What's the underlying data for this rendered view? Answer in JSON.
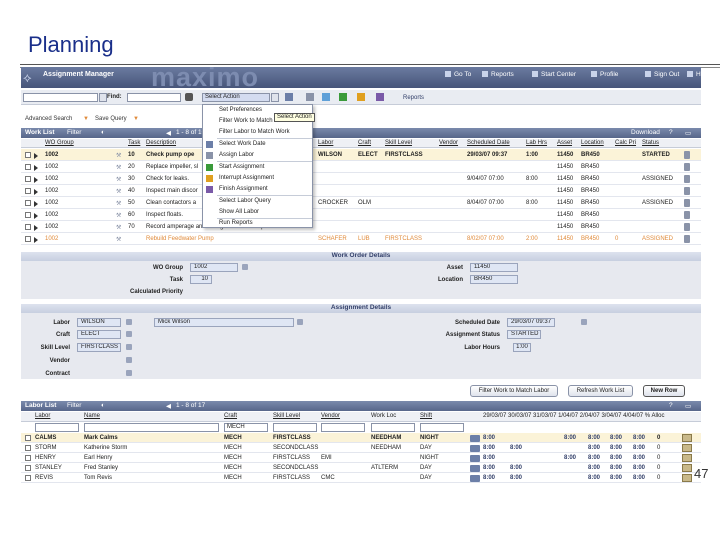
{
  "slide": {
    "title": "Planning",
    "page_number": "47"
  },
  "app": {
    "logo_glyph": "⟡",
    "title": "Assignment Manager",
    "watermark": "maximo",
    "nav": [
      "Go To",
      "Reports",
      "Start Center",
      "Profile",
      "Sign Out",
      "He"
    ]
  },
  "toolbar": {
    "find_label": "Find:",
    "action_select": "Select Action",
    "reports_label": "Reports"
  },
  "links": {
    "advanced_search": "Advanced Search",
    "save_query": "Save Query"
  },
  "work_list": {
    "title": "Work List",
    "filter": "Filter",
    "paging": "1 - 8 of 10",
    "download": "Download",
    "columns": [
      "WO Group",
      "Task",
      "Description",
      "Labor",
      "Craft",
      "Skill Level",
      "Vendor",
      "Scheduled Date",
      "Lab Hrs",
      "Asset",
      "Location",
      "Calc Pri",
      "Status"
    ],
    "rows": [
      {
        "wo": "1002",
        "task": "10",
        "desc": "Check pump ope",
        "labor": "WILSON",
        "craft": "ELECT",
        "skill": "FIRSTCLASS",
        "vendor": "",
        "date": "29/03/07 09:37",
        "hrs": "1:00",
        "asset": "11450",
        "loc": "BR450",
        "pri": "",
        "status": "STARTED"
      },
      {
        "wo": "1002",
        "task": "20",
        "desc": "Replace impeller, sl",
        "labor": "",
        "craft": "",
        "skill": "",
        "vendor": "",
        "date": "",
        "hrs": "",
        "asset": "11450",
        "loc": "BR450",
        "pri": "",
        "status": ""
      },
      {
        "wo": "1002",
        "task": "30",
        "desc": "Check for leaks.",
        "labor": "",
        "craft": "",
        "skill": "",
        "vendor": "",
        "date": "9/04/07 07:00",
        "hrs": "8:00",
        "asset": "11450",
        "loc": "BR450",
        "pri": "",
        "status": "ASSIGNED"
      },
      {
        "wo": "1002",
        "task": "40",
        "desc": "Inspect main discor",
        "labor": "",
        "craft": "",
        "skill": "",
        "vendor": "",
        "date": "",
        "hrs": "",
        "asset": "11450",
        "loc": "BR450",
        "pri": "",
        "status": ""
      },
      {
        "wo": "1002",
        "task": "50",
        "desc": "Clean contactors a",
        "labor": "CROCKER",
        "craft": "OLM",
        "skill": "",
        "vendor": "",
        "date": "8/04/07 07:00",
        "hrs": "8:00",
        "asset": "11450",
        "loc": "BR450",
        "pri": "",
        "status": "ASSIGNED"
      },
      {
        "wo": "1002",
        "task": "60",
        "desc": "Inspect floats.",
        "labor": "",
        "craft": "",
        "skill": "",
        "vendor": "",
        "date": "",
        "hrs": "",
        "asset": "11450",
        "loc": "BR450",
        "pri": "",
        "status": ""
      },
      {
        "wo": "1002",
        "task": "70",
        "desc": "Record amperage and voltage with motor op...",
        "labor": "",
        "craft": "",
        "skill": "",
        "vendor": "",
        "date": "",
        "hrs": "",
        "asset": "11450",
        "loc": "BR450",
        "pri": "",
        "status": ""
      },
      {
        "wo": "1002",
        "task": "",
        "desc": "Rebuild Feedwater Pump",
        "labor": "SCHAFER",
        "craft": "LUB",
        "skill": "FIRSTCLASS",
        "vendor": "",
        "date": "8/02/07 07:00",
        "hrs": "2:00",
        "asset": "11450",
        "loc": "BR450",
        "pri": "0",
        "status": "ASSIGNED"
      }
    ]
  },
  "menu": {
    "items": [
      "Set Preferences",
      "Filter Work to Match Labor",
      "Filter Labor to Match Work",
      "Select Work Date",
      "Assign Labor",
      "Start Assignment",
      "Interrupt Assignment",
      "Finish Assignment",
      "Select Labor Query",
      "Show All Labor",
      "Run Reports"
    ],
    "tooltip": "Select Action"
  },
  "work_order_details": {
    "title": "Work Order Details",
    "wo_group_label": "WO Group",
    "wo_group": "1002",
    "task_label": "Task",
    "task": "10",
    "calc_priority_label": "Calculated Priority",
    "asset_label": "Asset",
    "asset": "11450",
    "location_label": "Location",
    "location": "BR450"
  },
  "assignment_details": {
    "title": "Assignment Details",
    "labor_label": "Labor",
    "labor": "WILSON",
    "labor_name": "Mick Wilson",
    "craft_label": "Craft",
    "craft": "ELECT",
    "skill_label": "Skill Level",
    "skill": "FIRSTCLASS",
    "vendor_label": "Vendor",
    "contract_label": "Contract",
    "sched_label": "Scheduled Date",
    "sched": "29/03/07 09:37",
    "status_label": "Assignment Status",
    "status": "STARTED",
    "hours_label": "Labor Hours",
    "hours": "1:00"
  },
  "buttons": {
    "filter_work": "Filter Work to Match Labor",
    "refresh": "Refresh Work List",
    "new_row": "New Row"
  },
  "labor_list": {
    "title": "Labor List",
    "filter": "Filter",
    "paging": "1 - 8 of 17",
    "columns": [
      "Labor",
      "Name",
      "Craft",
      "Skill Level",
      "Vendor",
      "Work Loc",
      "Shift"
    ],
    "dates": "29/03/07 30/03/07 31/03/07 1/04/07 2/04/07 3/04/07 4/04/07 % Alloc",
    "craft_filter": "MECH",
    "rows": [
      {
        "labor": "CALMS",
        "name": "Mark Calms",
        "craft": "MECH",
        "skill": "FIRSTCLASS",
        "vendor": "",
        "loc": "NEEDHAM",
        "shift": "NIGHT",
        "h1": "8:00",
        "h2": "",
        "h3": "8:00",
        "h4": "8:00",
        "h5": "8:00",
        "h6": "8:00",
        "pct": "0",
        "bold": true
      },
      {
        "labor": "STORM",
        "name": "Katherine Storm",
        "craft": "MECH",
        "skill": "SECONDCLASS",
        "vendor": "",
        "loc": "NEEDHAM",
        "shift": "DAY",
        "h1": "8:00",
        "h2": "8:00",
        "h3": "",
        "h4": "8:00",
        "h5": "8:00",
        "h6": "8:00",
        "pct": "0",
        "bold": false
      },
      {
        "labor": "HENRY",
        "name": "Earl Henry",
        "craft": "MECH",
        "skill": "FIRSTCLASS",
        "vendor": "EMI",
        "loc": "",
        "shift": "NIGHT",
        "h1": "8:00",
        "h2": "",
        "h3": "8:00",
        "h4": "8:00",
        "h5": "8:00",
        "h6": "8:00",
        "pct": "0",
        "bold": false
      },
      {
        "labor": "STANLEY",
        "name": "Fred Stanley",
        "craft": "MECH",
        "skill": "SECONDCLASS",
        "vendor": "",
        "loc": "ATLTERM",
        "shift": "DAY",
        "h1": "8:00",
        "h2": "8:00",
        "h3": "",
        "h4": "8:00",
        "h5": "8:00",
        "h6": "8:00",
        "pct": "0",
        "bold": false
      },
      {
        "labor": "REVIS",
        "name": "Tom Revis",
        "craft": "MECH",
        "skill": "FIRSTCLASS",
        "vendor": "CMC",
        "loc": "",
        "shift": "DAY",
        "h1": "8:00",
        "h2": "8:00",
        "h3": "",
        "h4": "8:00",
        "h5": "8:00",
        "h6": "8:00",
        "pct": "0",
        "bold": false
      }
    ]
  }
}
